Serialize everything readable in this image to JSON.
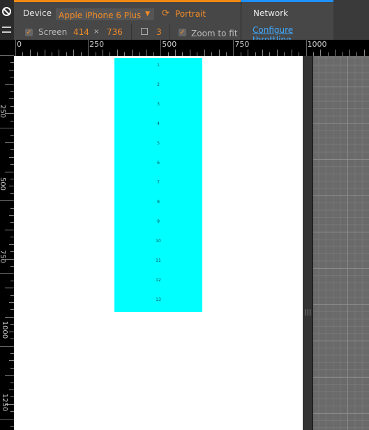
{
  "toolbar": {
    "device_label": "Device",
    "device_value": "Apple iPhone 6 Plus",
    "orientation_label": "Portrait",
    "screen_label": "Screen",
    "screen_checked": true,
    "screen_width": "414",
    "times": "×",
    "screen_height": "736",
    "device_pixel_ratio": "3",
    "zoom_to_fit_label": "Zoom to fit",
    "zoom_to_fit_checked": true
  },
  "network": {
    "title": "Network",
    "throttling_link": "Configure throttling"
  },
  "ruler": {
    "horizontal_labels": [
      "0",
      "250",
      "500",
      "750",
      "1000"
    ],
    "vertical_labels": [
      "250",
      "500",
      "750",
      "1000",
      "1250"
    ]
  },
  "page": {
    "items": [
      "1",
      "2",
      "3",
      "4",
      "5",
      "6",
      "7",
      "8",
      "9",
      "10",
      "11",
      "12",
      "13"
    ],
    "highlight_color": "#00ffff"
  },
  "colors": {
    "device_accent": "#f08a12",
    "network_accent": "#1e90ff",
    "link": "#3fa9ff"
  }
}
